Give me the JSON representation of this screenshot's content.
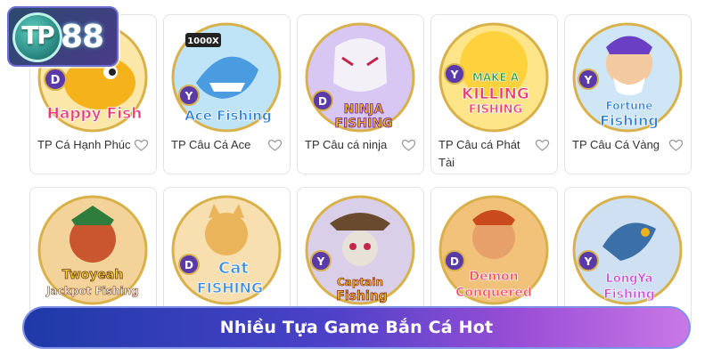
{
  "brand": {
    "logo_prefix": "TP",
    "logo_number": "88"
  },
  "games_row_1": [
    {
      "name": "TP Cá Hạnh Phúc",
      "art_title": "Happy Fish",
      "badge": "D",
      "accent": "#f5b21b"
    },
    {
      "name": "TP Câu Cá Ace",
      "art_title": "Ace Fishing",
      "badge": "Y",
      "accent": "#2f7fd6"
    },
    {
      "name": "TP Câu cá ninja",
      "art_title": "NINJA FISHING",
      "badge": "D",
      "accent": "#7a3fd1"
    },
    {
      "name": "TP Câu cá Phát Tài",
      "art_title": "MAKE A KILLING FISHING",
      "badge": "Y",
      "accent": "#f2b01e"
    },
    {
      "name": "TP Câu Cá Vàng",
      "art_title": "Fortune Fishing",
      "badge": "Y",
      "accent": "#e0a21c"
    }
  ],
  "games_row_2": [
    {
      "name": "",
      "art_title": "Twoyeah Jackpot Fishing",
      "badge": "",
      "accent": "#d9a21c"
    },
    {
      "name": "",
      "art_title": "Cat Fishing",
      "badge": "D",
      "accent": "#3c8fe0"
    },
    {
      "name": "",
      "art_title": "Captain Fishing",
      "badge": "Y",
      "accent": "#d9a21c"
    },
    {
      "name": "",
      "art_title": "Demon Conquered",
      "badge": "D",
      "accent": "#e06a1c"
    },
    {
      "name": "",
      "art_title": "LongYa Fishing",
      "badge": "Y",
      "accent": "#7a3fd1"
    }
  ],
  "banner": {
    "text": "Nhiều Tựa Game Bắn Cá Hot"
  },
  "icons": {
    "favorite": "heart-icon"
  }
}
